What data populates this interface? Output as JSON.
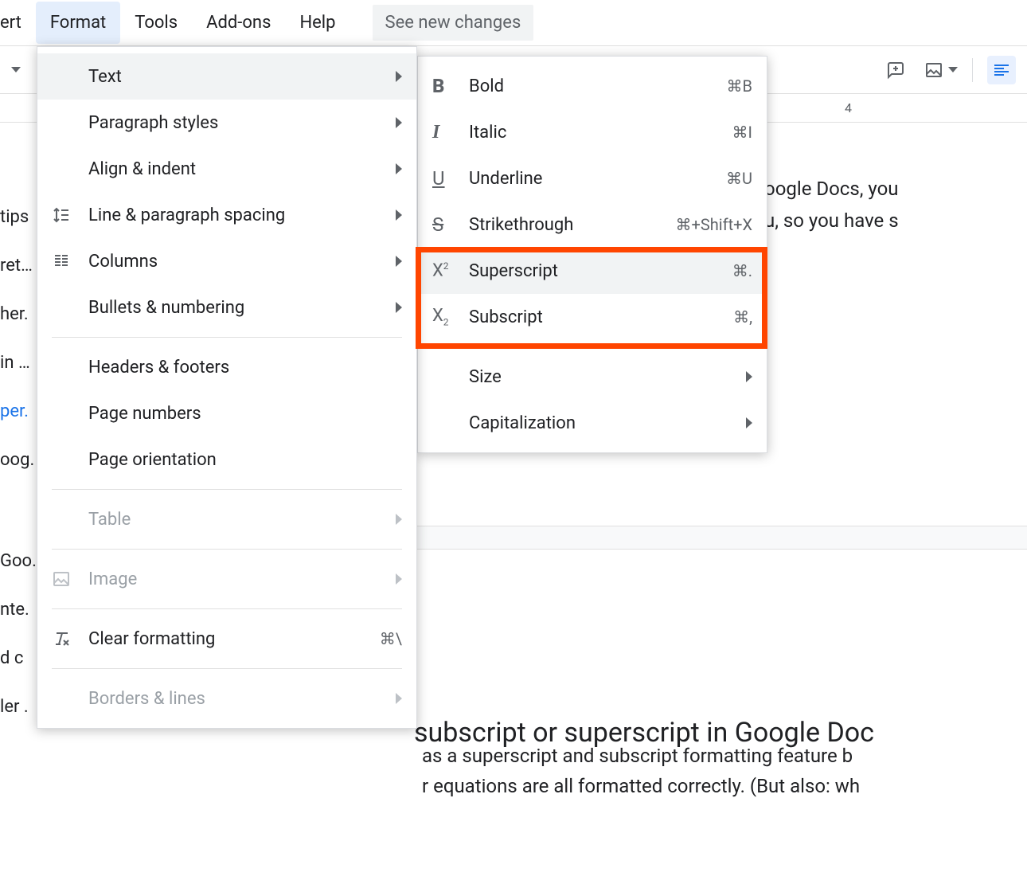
{
  "menubar": {
    "items": [
      "ert",
      "Format",
      "Tools",
      "Add-ons",
      "Help"
    ],
    "active_index": 1,
    "changes_button": "See new changes"
  },
  "ruler": {
    "num4": "4"
  },
  "toolbar": {
    "comment_icon": "add-comment-icon",
    "image_icon": "image-icon",
    "align_icon": "align-left-icon"
  },
  "left_strip": [
    {
      "text": "tips",
      "blue": false
    },
    {
      "text": "ret…",
      "blue": false
    },
    {
      "text": "her.",
      "blue": false
    },
    {
      "text": "in …",
      "blue": false
    },
    {
      "text": "per.",
      "blue": true
    },
    {
      "text": "oog.",
      "blue": false
    },
    {
      "text": "Goo.",
      "blue": false
    },
    {
      "text": "nte.",
      "blue": false
    },
    {
      "text": "d c",
      "blue": false
    },
    {
      "text": "ler .",
      "blue": false
    }
  ],
  "format_menu": {
    "items": [
      {
        "label": "Text",
        "has_icon": false,
        "submenu": true,
        "hovered": true,
        "disabled": false,
        "shortcut": ""
      },
      {
        "label": "Paragraph styles",
        "has_icon": false,
        "submenu": true,
        "hovered": false,
        "disabled": false,
        "shortcut": ""
      },
      {
        "label": "Align & indent",
        "has_icon": false,
        "submenu": true,
        "hovered": false,
        "disabled": false,
        "shortcut": ""
      },
      {
        "label": "Line & paragraph spacing",
        "icon": "line-spacing-icon",
        "submenu": true,
        "hovered": false,
        "disabled": false,
        "shortcut": ""
      },
      {
        "label": "Columns",
        "icon": "columns-icon",
        "submenu": true,
        "hovered": false,
        "disabled": false,
        "shortcut": ""
      },
      {
        "label": "Bullets & numbering",
        "has_icon": false,
        "submenu": true,
        "hovered": false,
        "disabled": false,
        "shortcut": ""
      },
      {
        "sep": true
      },
      {
        "label": "Headers & footers",
        "has_icon": false,
        "submenu": false,
        "hovered": false,
        "disabled": false,
        "shortcut": ""
      },
      {
        "label": "Page numbers",
        "has_icon": false,
        "submenu": false,
        "hovered": false,
        "disabled": false,
        "shortcut": ""
      },
      {
        "label": "Page orientation",
        "has_icon": false,
        "submenu": false,
        "hovered": false,
        "disabled": false,
        "shortcut": ""
      },
      {
        "sep": true
      },
      {
        "label": "Table",
        "has_icon": false,
        "submenu": true,
        "hovered": false,
        "disabled": true,
        "shortcut": ""
      },
      {
        "sep": true
      },
      {
        "label": "Image",
        "icon": "image-outline-icon",
        "submenu": true,
        "hovered": false,
        "disabled": true,
        "shortcut": ""
      },
      {
        "sep": true
      },
      {
        "label": "Clear formatting",
        "icon": "clear-format-icon",
        "submenu": false,
        "hovered": false,
        "disabled": false,
        "shortcut": "⌘\\"
      },
      {
        "sep": true
      },
      {
        "label": "Borders & lines",
        "has_icon": false,
        "submenu": true,
        "hovered": false,
        "disabled": true,
        "shortcut": ""
      }
    ]
  },
  "text_submenu": {
    "items": [
      {
        "label": "Bold",
        "icon": "bold-icon",
        "shortcut": "⌘B",
        "hovered": false
      },
      {
        "label": "Italic",
        "icon": "italic-icon",
        "shortcut": "⌘I",
        "hovered": false
      },
      {
        "label": "Underline",
        "icon": "underline-icon",
        "shortcut": "⌘U",
        "hovered": false
      },
      {
        "label": "Strikethrough",
        "icon": "strikethrough-icon",
        "shortcut": "⌘+Shift+X",
        "hovered": false
      },
      {
        "label": "Superscript",
        "icon": "superscript-icon",
        "shortcut": "⌘.",
        "hovered": true
      },
      {
        "label": "Subscript",
        "icon": "subscript-icon",
        "shortcut": "⌘,",
        "hovered": false
      },
      {
        "sep": true
      },
      {
        "label": "Size",
        "submenu": true
      },
      {
        "label": "Capitalization",
        "submenu": true
      }
    ]
  },
  "doc": {
    "p1a": "oogle Docs, you",
    "p1b": "u, so you have s",
    "h": "subscript or superscript in Google Doc",
    "p2a": "as a superscript and subscript formatting feature b",
    "p2b": "r equations are all formatted correctly. (But also: wh"
  }
}
